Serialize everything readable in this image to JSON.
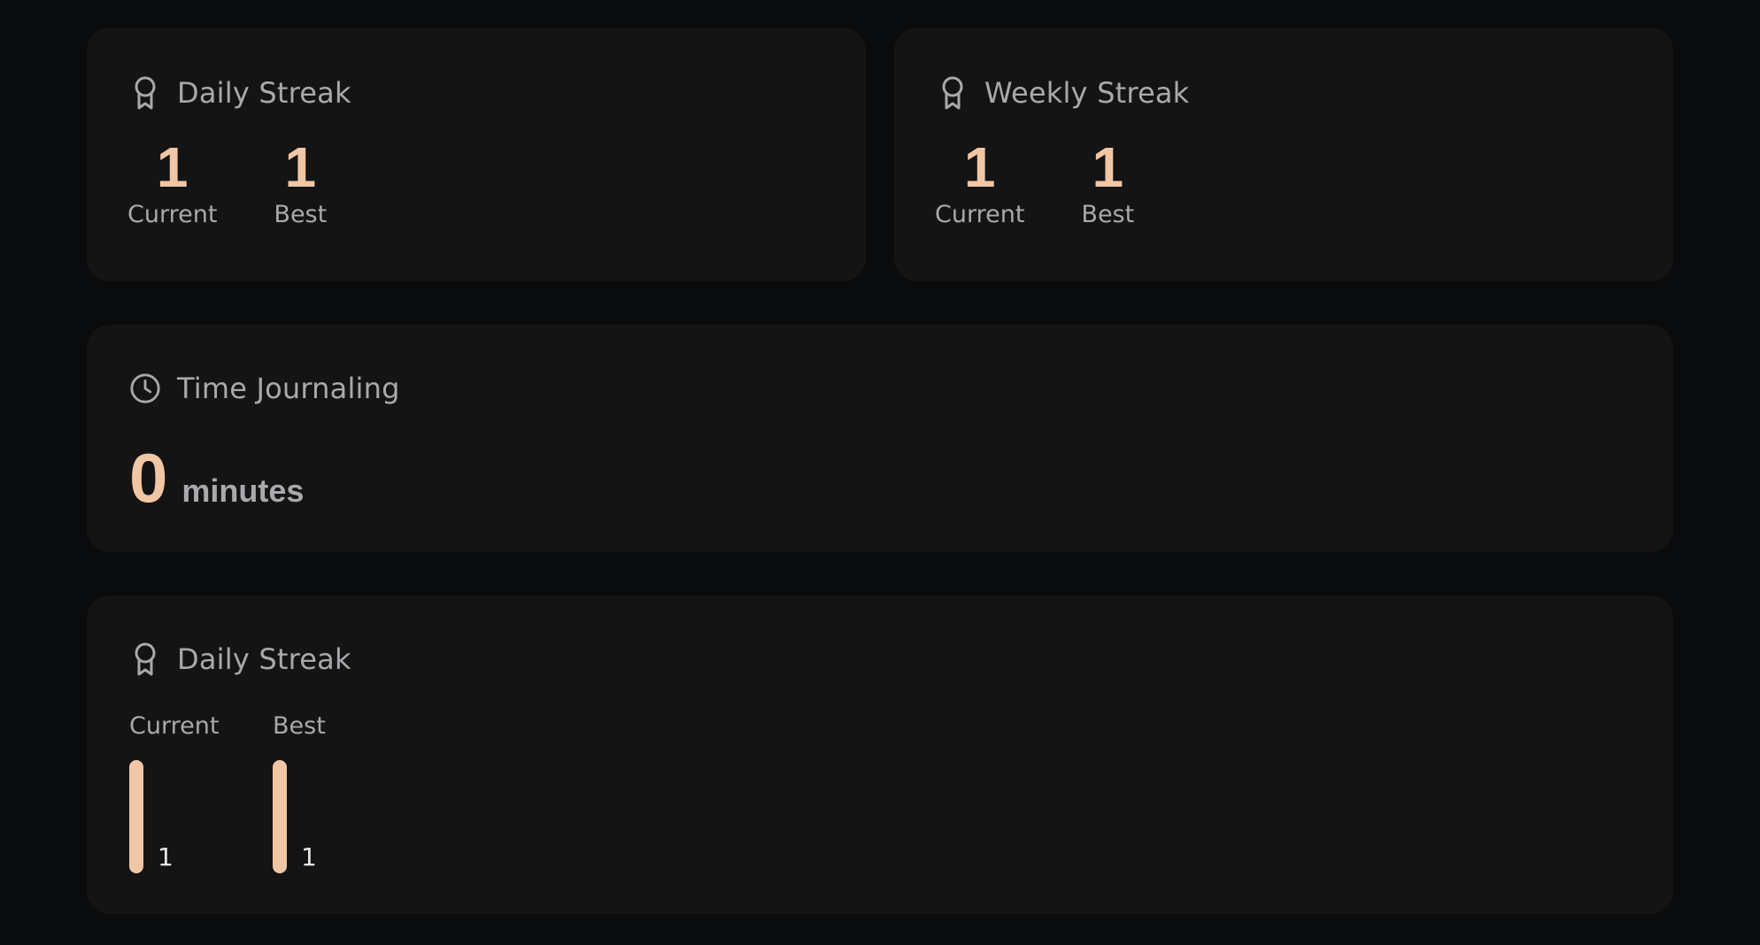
{
  "colors": {
    "background": "#0a0b0d",
    "card": "#141414",
    "accent": "#f1c6a5",
    "muted": "#a9a9ad"
  },
  "daily_streak": {
    "icon": "award-ribbon-icon",
    "title": "Daily Streak",
    "current_value": "1",
    "current_label": "Current",
    "best_value": "1",
    "best_label": "Best"
  },
  "weekly_streak": {
    "icon": "award-ribbon-icon",
    "title": "Weekly Streak",
    "current_value": "1",
    "current_label": "Current",
    "best_value": "1",
    "best_label": "Best"
  },
  "time_journaling": {
    "icon": "clock-icon",
    "title": "Time Journaling",
    "value": "0",
    "unit": "minutes"
  },
  "daily_streak_bars": {
    "icon": "award-ribbon-icon",
    "title": "Daily Streak",
    "bars": [
      {
        "label": "Current",
        "value": 1,
        "display": "1",
        "fill_fraction": 1.0
      },
      {
        "label": "Best",
        "value": 1,
        "display": "1",
        "fill_fraction": 1.0
      }
    ]
  }
}
